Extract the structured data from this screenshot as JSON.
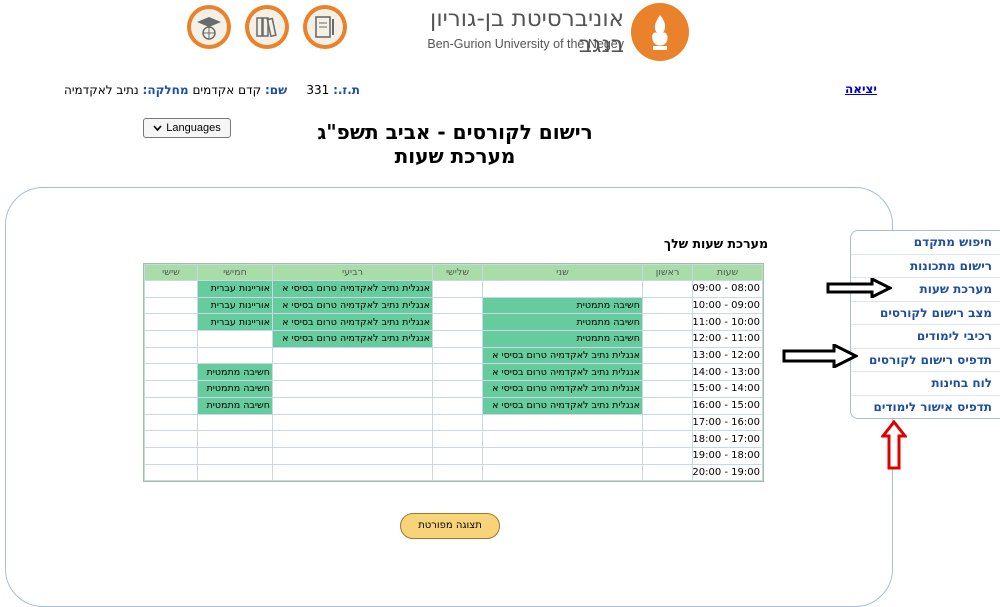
{
  "header": {
    "university_he": "אוניברסיטת בן-גוריון בנגב",
    "university_en": "Ben-Gurion University of the Negev",
    "icons": [
      "document-pen-icon",
      "books-icon",
      "graduation-globe-icon"
    ]
  },
  "user": {
    "id_label": "ת.ז.:",
    "id_value": "331",
    "name_label": "שם:",
    "name_value": "קדם אקדמים",
    "dept_label": "מחלקה:",
    "dept_value": "נתיב לאקדמיה"
  },
  "logout_label": "יציאה",
  "languages_label": "Languages",
  "page_title_line1": "רישום לקורסים - אביב תשפ\"ג",
  "page_title_line2": "מערכת שעות",
  "schedule_title": "מערכת שעות שלך",
  "table": {
    "headers": [
      "שעות",
      "ראשון",
      "שני",
      "שלישי",
      "רביעי",
      "חמישי",
      "שישי"
    ],
    "rows": [
      {
        "time": "08:00 - 09:00",
        "mon": "",
        "wed": "אנגלית נתיב לאקדמיה טרום בסיסי א",
        "thu": "אוריינות עברית"
      },
      {
        "time": "09:00 - 10:00",
        "mon": "חשיבה מתמטית",
        "wed": "אנגלית נתיב לאקדמיה טרום בסיסי א",
        "thu": "אוריינות עברית"
      },
      {
        "time": "10:00 - 11:00",
        "mon": "חשיבה מתמטית",
        "wed": "אנגלית נתיב לאקדמיה טרום בסיסי א",
        "thu": "אוריינות עברית"
      },
      {
        "time": "11:00 - 12:00",
        "mon": "חשיבה מתמטית",
        "wed": "אנגלית נתיב לאקדמיה טרום בסיסי א",
        "thu": ""
      },
      {
        "time": "12:00 - 13:00",
        "mon": "אנגלית נתיב לאקדמיה טרום בסיסי א",
        "wed": "",
        "thu": ""
      },
      {
        "time": "13:00 - 14:00",
        "mon": "אנגלית נתיב לאקדמיה טרום בסיסי א",
        "wed": "",
        "thu": "חשיבה מתמטית"
      },
      {
        "time": "14:00 - 15:00",
        "mon": "אנגלית נתיב לאקדמיה טרום בסיסי א",
        "wed": "",
        "thu": "חשיבה מתמטית"
      },
      {
        "time": "15:00 - 16:00",
        "mon": "אנגלית נתיב לאקדמיה טרום בסיסי א",
        "wed": "",
        "thu": "חשיבה מתמטית"
      },
      {
        "time": "16:00 - 17:00",
        "mon": "",
        "wed": "",
        "thu": ""
      },
      {
        "time": "17:00 - 18:00",
        "mon": "",
        "wed": "",
        "thu": ""
      },
      {
        "time": "18:00 - 19:00",
        "mon": "",
        "wed": "",
        "thu": ""
      },
      {
        "time": "19:00 - 20:00",
        "mon": "",
        "wed": "",
        "thu": ""
      }
    ]
  },
  "print_button_label": "תצוגה מפורטת",
  "menu": [
    "חיפוש מתקדם",
    "רישום מתכונות",
    "מערכת שעות",
    "מצב רישום לקורסים",
    "רכיבי לימודים",
    "תדפיס רישום לקורסים",
    "לוח בחינות",
    "תדפיס אישור לימודים"
  ],
  "colors": {
    "accent_orange": "#e9822a",
    "course_cell": "#66cc9e",
    "header_row": "#a8dda8",
    "menu_text": "#1f4fa0",
    "annotation_arrow_red": "#e00000",
    "annotation_arrow_black": "#000000"
  }
}
